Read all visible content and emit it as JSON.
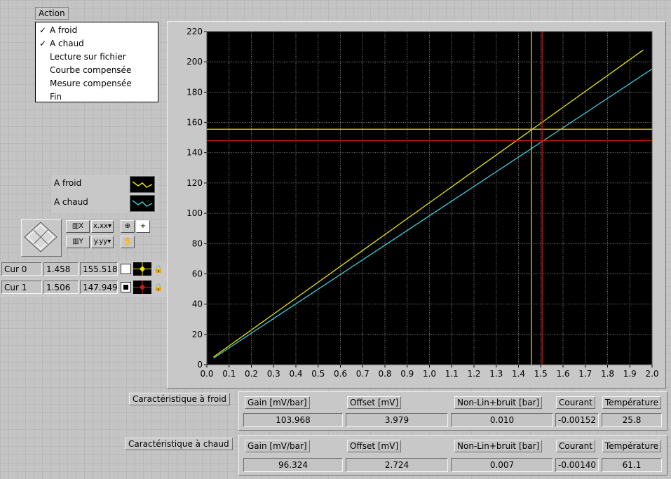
{
  "action": {
    "label": "Action",
    "items": [
      {
        "label": "A froid",
        "checked": true
      },
      {
        "label": "A chaud",
        "checked": true
      },
      {
        "label": "Lecture sur fichier",
        "checked": false
      },
      {
        "label": "Courbe compensée",
        "checked": false
      },
      {
        "label": "Mesure compensée",
        "checked": false
      },
      {
        "label": "Fin",
        "checked": false
      }
    ]
  },
  "legend": {
    "items": [
      {
        "label": "A froid",
        "color": "#e8e800"
      },
      {
        "label": "A chaud",
        "color": "#40c8d8"
      }
    ]
  },
  "cursors": [
    {
      "name": "Cur 0",
      "x": "1.458",
      "y": "155.518",
      "color": "#e8e800"
    },
    {
      "name": "Cur 1",
      "x": "1.506",
      "y": "147.949",
      "color": "#d01818"
    }
  ],
  "chart_data": {
    "type": "line",
    "xlim": [
      0.0,
      2.0
    ],
    "ylim": [
      0,
      220
    ],
    "x_ticks": [
      "0.0",
      "0.1",
      "0.2",
      "0.3",
      "0.4",
      "0.5",
      "0.6",
      "0.7",
      "0.8",
      "0.9",
      "1.0",
      "1.1",
      "1.2",
      "1.3",
      "1.4",
      "1.5",
      "1.6",
      "1.7",
      "1.8",
      "1.9",
      "2.0"
    ],
    "y_ticks": [
      "0",
      "20",
      "40",
      "60",
      "80",
      "100",
      "120",
      "140",
      "160",
      "180",
      "200",
      "220"
    ],
    "grid": true,
    "background": "#000000",
    "series": [
      {
        "name": "A froid",
        "color": "#e8e800",
        "x": [
          0.03,
          1.96
        ],
        "y": [
          5.1,
          207.8
        ]
      },
      {
        "name": "A chaud",
        "color": "#40c8d8",
        "x": [
          0.03,
          2.0
        ],
        "y": [
          4.3,
          195.3
        ]
      }
    ],
    "cursors": [
      {
        "x": 1.458,
        "y": 155.518,
        "color": "#e8e800"
      },
      {
        "x": 1.506,
        "y": 147.949,
        "color": "#d01818"
      }
    ]
  },
  "froid": {
    "caption": "Caractéristique à froid",
    "headers": [
      "Gain [mV/bar]",
      "Offset [mV]",
      "Non-Lin+bruit [bar]",
      "Courant",
      "Température"
    ],
    "values": [
      "103.968",
      "3.979",
      "0.010",
      "-0.00152",
      "25.8"
    ]
  },
  "chaud": {
    "caption": "Caractéristique à chaud",
    "headers": [
      "Gain [mV/bar]",
      "Offset [mV]",
      "Non-Lin+bruit [bar]",
      "Courant",
      "Température"
    ],
    "values": [
      "96.324",
      "2.724",
      "0.007",
      "-0.00140",
      "61.1"
    ]
  }
}
